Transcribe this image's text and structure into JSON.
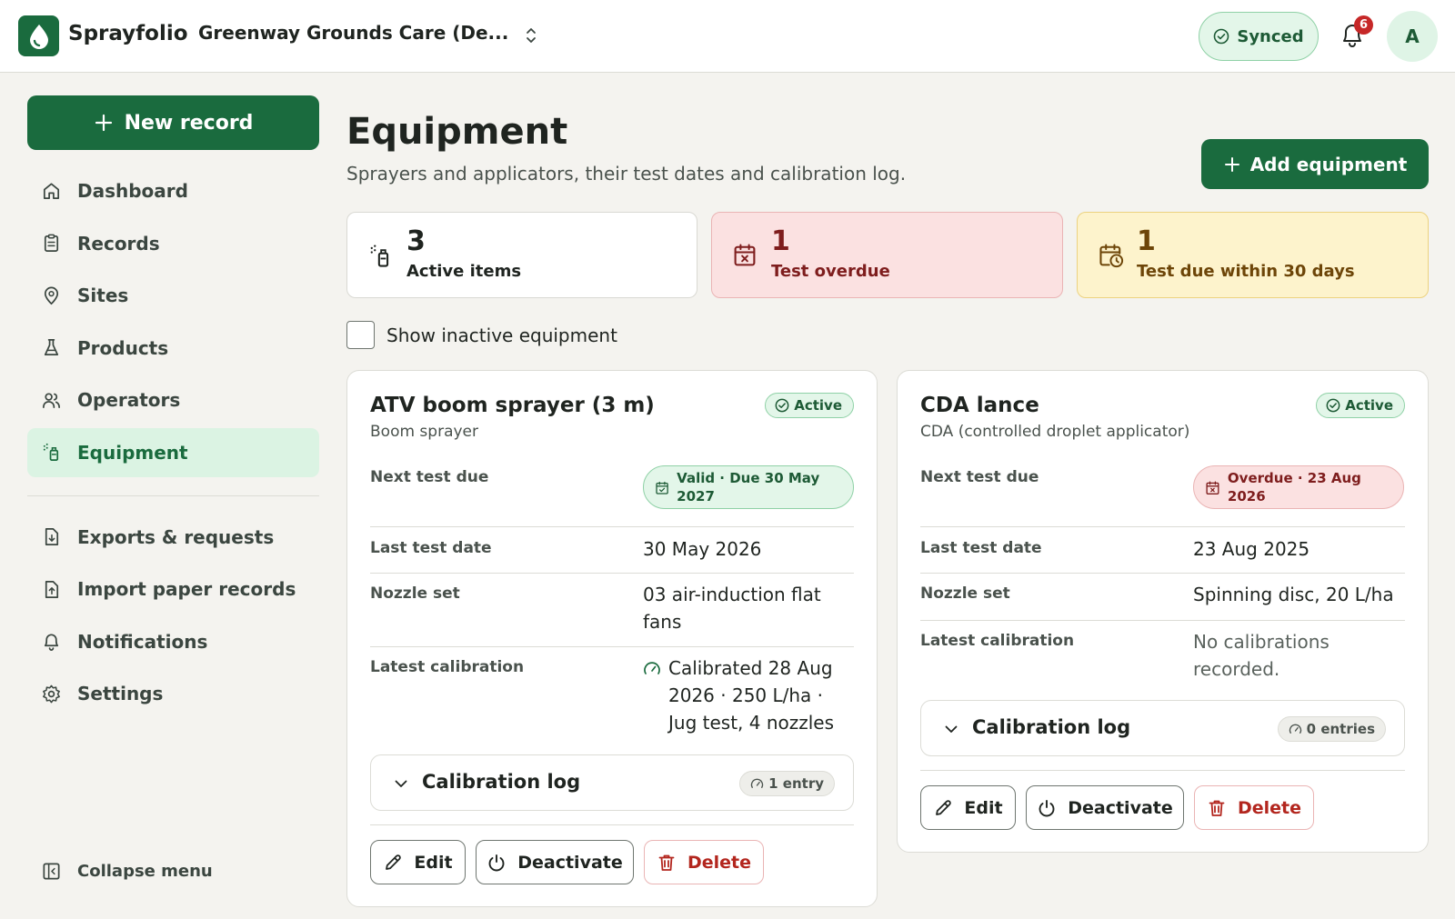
{
  "app": {
    "brand": "Sprayfolio",
    "org_name": "Greenway Grounds Care (De...",
    "sync_status": "Synced",
    "notification_count": "6",
    "avatar_initial": "A",
    "accent_color": "#1a6b3e"
  },
  "sidebar": {
    "new_record_label": "New record",
    "items": [
      {
        "label": "Dashboard",
        "icon": "home-icon"
      },
      {
        "label": "Records",
        "icon": "clipboard-icon"
      },
      {
        "label": "Sites",
        "icon": "map-pin-icon"
      },
      {
        "label": "Products",
        "icon": "flask-icon"
      },
      {
        "label": "Operators",
        "icon": "users-icon"
      },
      {
        "label": "Equipment",
        "icon": "sprayer-icon",
        "active": true
      }
    ],
    "secondary_items": [
      {
        "label": "Exports & requests",
        "icon": "file-download-icon"
      },
      {
        "label": "Import paper records",
        "icon": "file-upload-icon"
      },
      {
        "label": "Notifications",
        "icon": "bell-icon"
      },
      {
        "label": "Settings",
        "icon": "gear-icon"
      }
    ],
    "collapse_label": "Collapse menu"
  },
  "page": {
    "title": "Equipment",
    "subtitle": "Sprayers and applicators, their test dates and calibration log.",
    "add_button_label": "Add equipment"
  },
  "stats": [
    {
      "number": "3",
      "label": "Active items",
      "tone": "neutral"
    },
    {
      "number": "1",
      "label": "Test overdue",
      "tone": "red"
    },
    {
      "number": "1",
      "label": "Test due within 30 days",
      "tone": "yellow"
    }
  ],
  "filter": {
    "show_inactive_label": "Show inactive equipment",
    "checked": false
  },
  "field_labels": {
    "next_test": "Next test due",
    "last_test": "Last test date",
    "nozzle": "Nozzle set",
    "calibration": "Latest calibration"
  },
  "calibration_log_label": "Calibration log",
  "actions": {
    "edit": "Edit",
    "deactivate": "Deactivate",
    "delete": "Delete"
  },
  "equipment": [
    {
      "name": "ATV boom sprayer (3 m)",
      "type": "Boom sprayer",
      "status": "Active",
      "next_test_status": "Valid · Due 30 May 2027",
      "next_test_tone": "green",
      "last_test_date": "30 May 2026",
      "nozzle_set": "03 air-induction flat fans",
      "latest_calibration": "Calibrated 28 Aug 2026 · 250 L/ha · Jug test, 4 nozzles",
      "calibration_entries": "1 entry"
    },
    {
      "name": "CDA lance",
      "type": "CDA (controlled droplet applicator)",
      "status": "Active",
      "next_test_status": "Overdue · 23 Aug 2026",
      "next_test_tone": "red",
      "last_test_date": "23 Aug 2025",
      "nozzle_set": "Spinning disc, 20 L/ha",
      "latest_calibration": "No calibrations recorded.",
      "calibration_entries": "0 entries"
    }
  ]
}
